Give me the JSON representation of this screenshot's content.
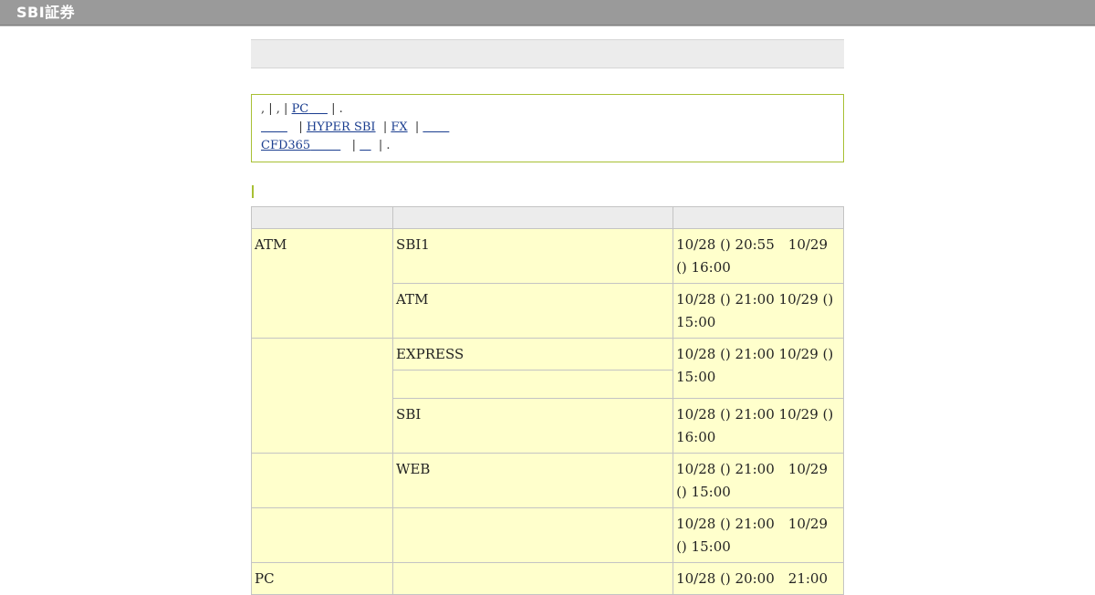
{
  "header": {
    "logo_text": "SBI証券"
  },
  "notice": {
    "line1_prefix": ", | , |",
    "line1_link_pc": "PC",
    "line1_suffix": "| .",
    "line2_link_blank": "",
    "line2_sep1": "|",
    "line2_link_hyper": "HYPER SBI",
    "line2_sep2": "|",
    "line2_link_fx": "FX",
    "line2_sep3": "|",
    "line2_link_blank2": "",
    "line3_link_cfd": "CFD365",
    "line3_sep1": "|",
    "line3_link_blank": "",
    "line3_suffix": "| ."
  },
  "table": {
    "headers": [
      "",
      "",
      ""
    ],
    "rows": {
      "r1": {
        "cat": "ATM",
        "svc": "SBI1",
        "time": "10/28 () 20:55　10/29 () 16:00"
      },
      "r2": {
        "svc": "ATM",
        "time": "10/28 () 21:00  10/29 () 15:00"
      },
      "r3": {
        "cat": "",
        "svc": "EXPRESS",
        "time": "10/28 () 21:00  10/29 () 15:00"
      },
      "r4": {
        "svc": ""
      },
      "r5": {
        "svc": "SBI",
        "time": "10/28 () 21:00  10/29 () 16:00"
      },
      "r6": {
        "cat": "",
        "svc": "WEB",
        "time": "10/28 () 21:00　10/29 () 15:00"
      },
      "r7": {
        "cat": "",
        "svc": "",
        "time": "10/28 () 21:00　10/29 () 15:00"
      },
      "r8": {
        "cat": "PC",
        "svc": "",
        "time": "10/28 () 20:00　21:00"
      }
    }
  },
  "colors": {
    "topbar": "#9a9a9a",
    "accent_green": "#a8c034",
    "table_cell_bg": "#ffffcc",
    "table_header_bg": "#ececec",
    "link": "#1a3d8f"
  }
}
